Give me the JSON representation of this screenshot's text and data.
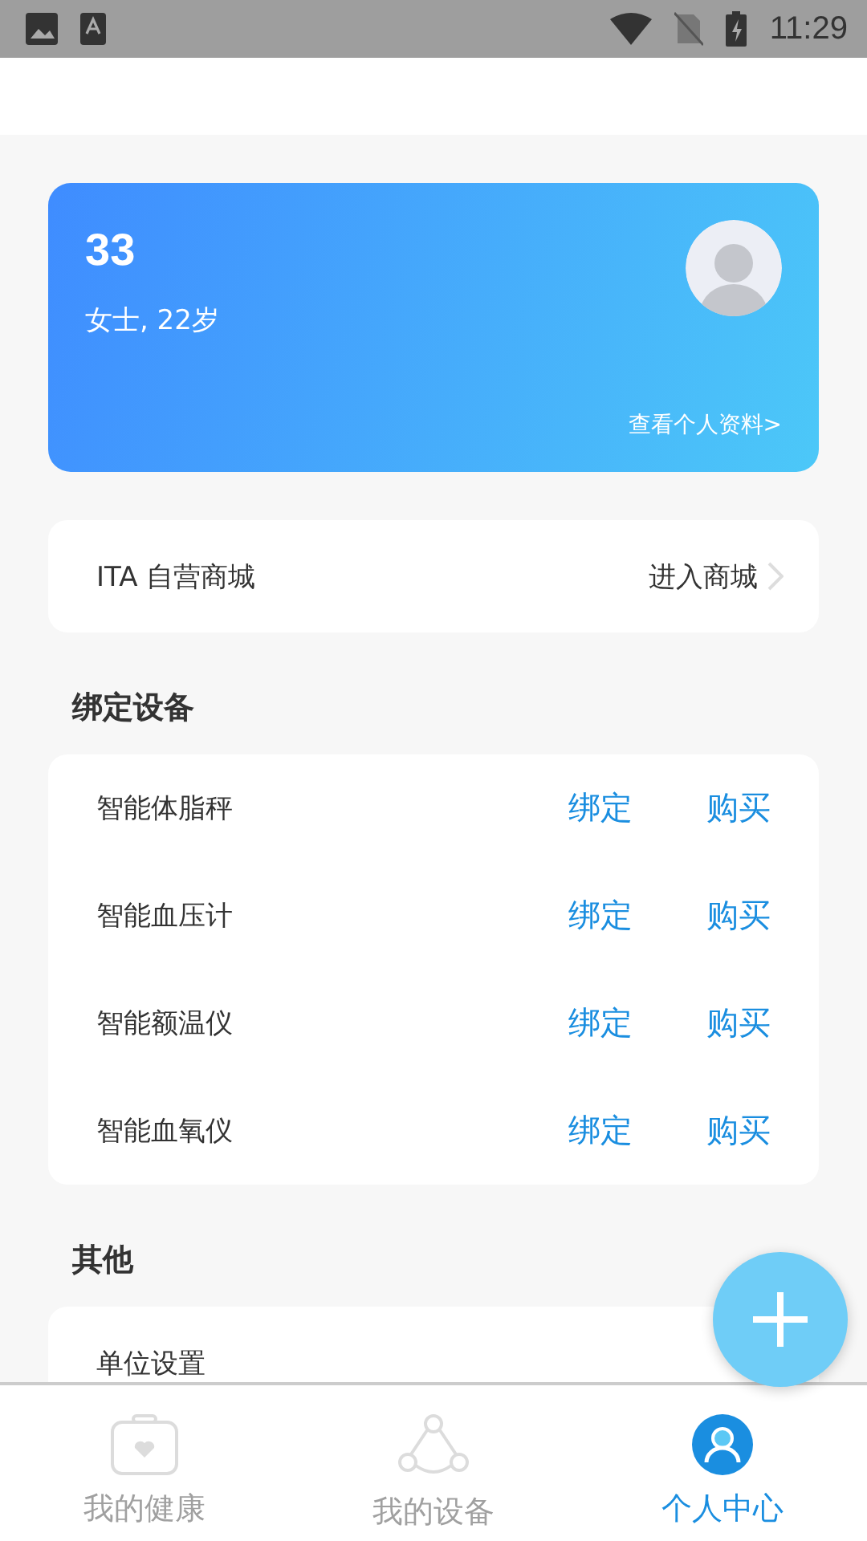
{
  "status_bar": {
    "time": "11:29"
  },
  "profile": {
    "name": "33",
    "info": "女士, 22岁",
    "link": "查看个人资料>"
  },
  "store": {
    "label": "ITA 自营商城",
    "action": "进入商城"
  },
  "devices_section": {
    "title": "绑定设备",
    "items": [
      {
        "name": "智能体脂秤",
        "bind": "绑定",
        "buy": "购买"
      },
      {
        "name": "智能血压计",
        "bind": "绑定",
        "buy": "购买"
      },
      {
        "name": "智能额温仪",
        "bind": "绑定",
        "buy": "购买"
      },
      {
        "name": "智能血氧仪",
        "bind": "绑定",
        "buy": "购买"
      }
    ]
  },
  "other_section": {
    "title": "其他",
    "items": [
      {
        "label": "单位设置"
      }
    ]
  },
  "tabs": [
    {
      "kind": "health",
      "label": "我的健康",
      "selected": false
    },
    {
      "kind": "devices",
      "label": "我的设备",
      "selected": false
    },
    {
      "kind": "profile",
      "label": "个人中心",
      "selected": true
    }
  ]
}
